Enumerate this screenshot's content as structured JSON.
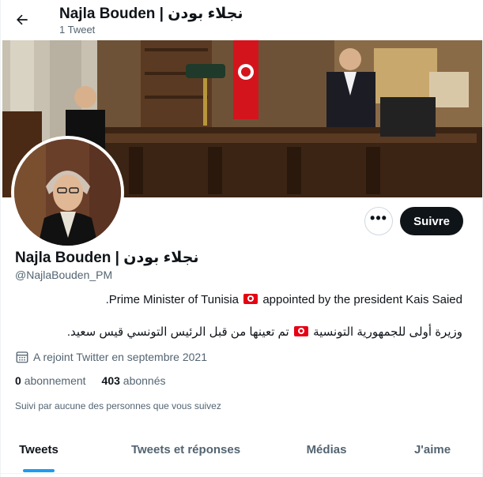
{
  "header": {
    "title": "Najla Bouden | نجلاء بودن",
    "tweet_count": "1 Tweet"
  },
  "profile": {
    "name": "Najla Bouden | نجلاء بودن",
    "handle": "@NajlaBouden_PM",
    "bio_line1_before": ".Prime Minister of Tunisia",
    "bio_line1_after": "appointed by the president Kais Saied",
    "bio_line2_before": "وزيرة أولى للجمهورية التونسية",
    "bio_line2_after": "تم تعينها من قبل الرئيس التونسي قيس سعيد.",
    "joined": "A rejoint Twitter en septembre 2021",
    "following_count": "0",
    "following_label": "abonnement",
    "followers_count": "403",
    "followers_label": "abonnés",
    "followed_by_note": "Suivi par aucune des personnes que vous suivez"
  },
  "actions": {
    "more_label": "•••",
    "follow_label": "Suivre"
  },
  "tabs": [
    {
      "label": "Tweets",
      "active": true
    },
    {
      "label": "Tweets et réponses",
      "active": false
    },
    {
      "label": "Médias",
      "active": false
    },
    {
      "label": "J'aime",
      "active": false
    }
  ],
  "colors": {
    "accent": "#1d9bf0",
    "text_primary": "#0f1419",
    "text_secondary": "#536471",
    "tunisia_red": "#e70013"
  },
  "icons": {
    "back": "arrow-left-icon",
    "calendar": "calendar-icon",
    "flag": "tunisia-flag-icon"
  }
}
